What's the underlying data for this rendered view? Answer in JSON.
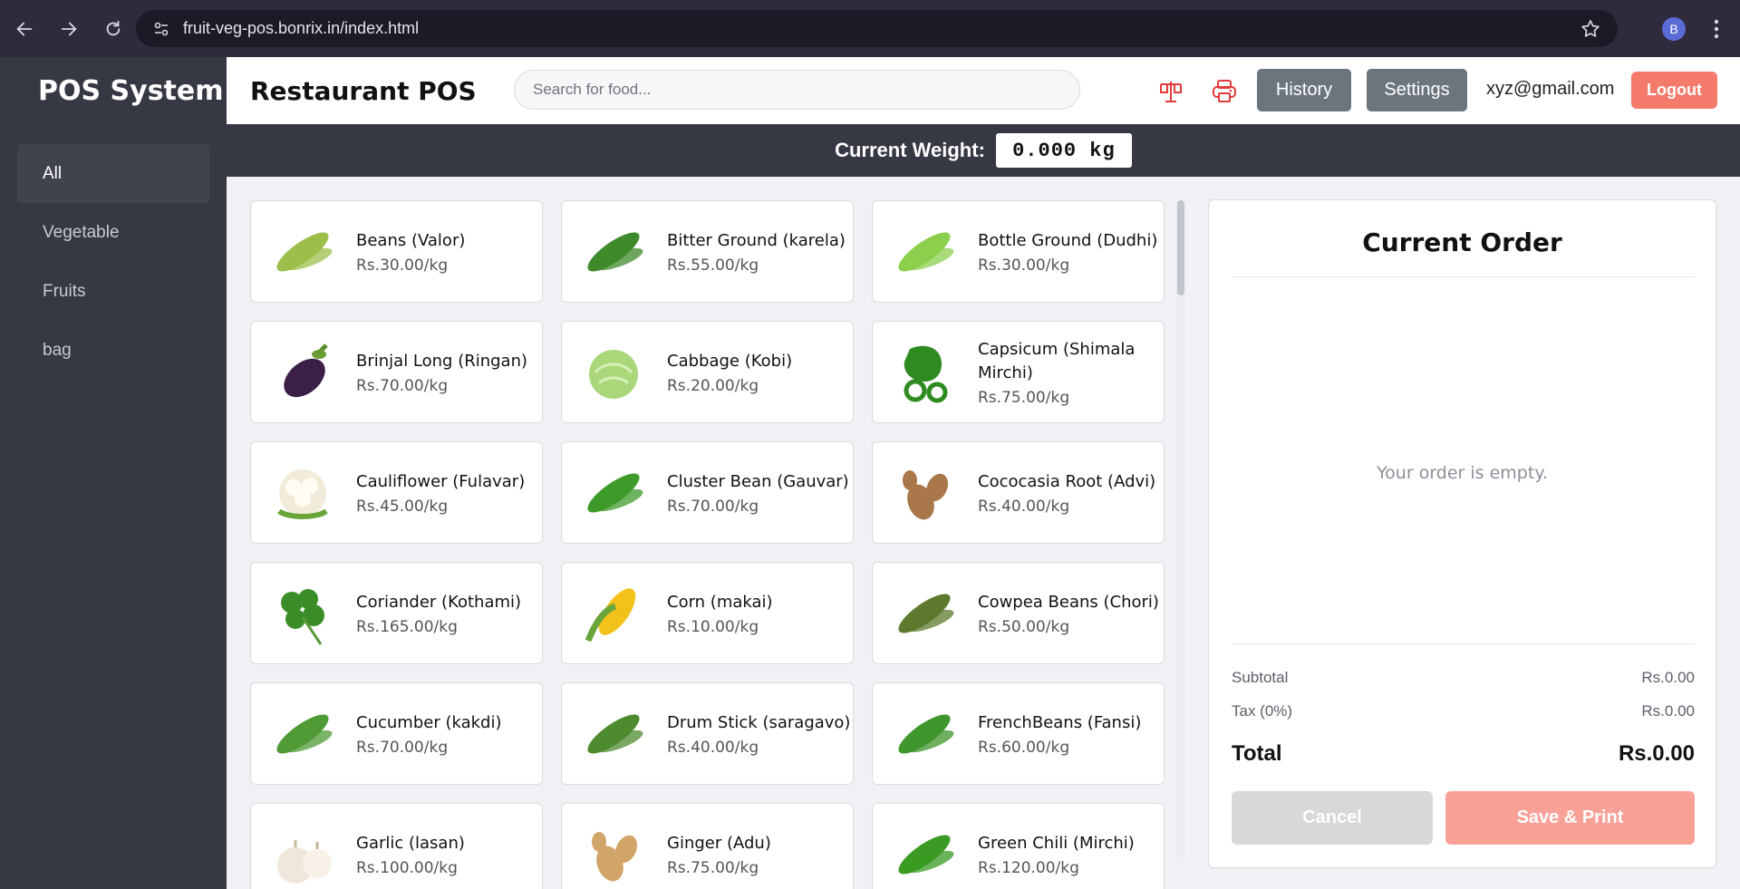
{
  "browser": {
    "url": "fruit-veg-pos.bonrix.in/index.html",
    "profile_initial": "B"
  },
  "sidebar": {
    "brand": "POS System",
    "categories": [
      {
        "label": "All",
        "active": true
      },
      {
        "label": "Vegetable",
        "active": false
      },
      {
        "label": "Fruits",
        "active": false
      },
      {
        "label": "bag",
        "active": false
      }
    ]
  },
  "header": {
    "title": "Restaurant POS",
    "search_placeholder": "Search for food...",
    "history_label": "History",
    "settings_label": "Settings",
    "email": "xyz@gmail.com",
    "logout_label": "Logout"
  },
  "weight": {
    "label": "Current Weight:",
    "value": "0.000 kg"
  },
  "products": [
    {
      "name": "Beans (Valor)",
      "price": "Rs.30.00/kg",
      "icon": "beans-icon",
      "color": "#9bbf4a"
    },
    {
      "name": "Bitter Ground (karela)",
      "price": "Rs.55.00/kg",
      "icon": "bitter-gourd-icon",
      "color": "#3f8a2b"
    },
    {
      "name": "Bottle Ground (Dudhi)",
      "price": "Rs.30.00/kg",
      "icon": "bottle-gourd-icon",
      "color": "#8ccf4d"
    },
    {
      "name": "Brinjal Long (Ringan)",
      "price": "Rs.70.00/kg",
      "icon": "brinjal-icon",
      "color": "#3b1f47"
    },
    {
      "name": "Cabbage (Kobi)",
      "price": "Rs.20.00/kg",
      "icon": "cabbage-icon",
      "color": "#a9d77a"
    },
    {
      "name": "Capsicum (Shimala Mirchi)",
      "price": "Rs.75.00/kg",
      "icon": "capsicum-icon",
      "color": "#2e8b1f"
    },
    {
      "name": "Cauliflower (Fulavar)",
      "price": "Rs.45.00/kg",
      "icon": "cauliflower-icon",
      "color": "#f1ecd9"
    },
    {
      "name": "Cluster Bean (Gauvar)",
      "price": "Rs.70.00/kg",
      "icon": "cluster-bean-icon",
      "color": "#3e9a2a"
    },
    {
      "name": "Cococasia Root (Advi)",
      "price": "Rs.40.00/kg",
      "icon": "cococasia-root-icon",
      "color": "#a9774a"
    },
    {
      "name": "Coriander (Kothami)",
      "price": "Rs.165.00/kg",
      "icon": "coriander-icon",
      "color": "#3b8d27"
    },
    {
      "name": "Corn (makai)",
      "price": "Rs.10.00/kg",
      "icon": "corn-icon",
      "color": "#f2c21b"
    },
    {
      "name": "Cowpea Beans (Chori)",
      "price": "Rs.50.00/kg",
      "icon": "cowpea-beans-icon",
      "color": "#5d7a2e"
    },
    {
      "name": "Cucumber (kakdi)",
      "price": "Rs.70.00/kg",
      "icon": "cucumber-icon",
      "color": "#4f9a35"
    },
    {
      "name": "Drum Stick (saragavo)",
      "price": "Rs.40.00/kg",
      "icon": "drum-stick-icon",
      "color": "#4e8a2e"
    },
    {
      "name": "FrenchBeans (Fansi)",
      "price": "Rs.60.00/kg",
      "icon": "french-beans-icon",
      "color": "#3f962c"
    },
    {
      "name": "Garlic (lasan)",
      "price": "Rs.100.00/kg",
      "icon": "garlic-icon",
      "color": "#efe6dc"
    },
    {
      "name": "Ginger (Adu)",
      "price": "Rs.75.00/kg",
      "icon": "ginger-icon",
      "color": "#d1a468"
    },
    {
      "name": "Green Chili (Mirchi)",
      "price": "Rs.120.00/kg",
      "icon": "green-chili-icon",
      "color": "#3a9a23"
    }
  ],
  "order": {
    "title": "Current Order",
    "empty_message": "Your order is empty.",
    "subtotal_label": "Subtotal",
    "subtotal_value": "Rs.0.00",
    "tax_label": "Tax (0%)",
    "tax_value": "Rs.0.00",
    "total_label": "Total",
    "total_value": "Rs.0.00",
    "cancel_label": "Cancel",
    "save_label": "Save & Print"
  },
  "colors": {
    "sidebar_bg": "#363943",
    "logout": "#f47a6c",
    "icon_red": "#e23b3b",
    "header_button": "#6c757d"
  }
}
